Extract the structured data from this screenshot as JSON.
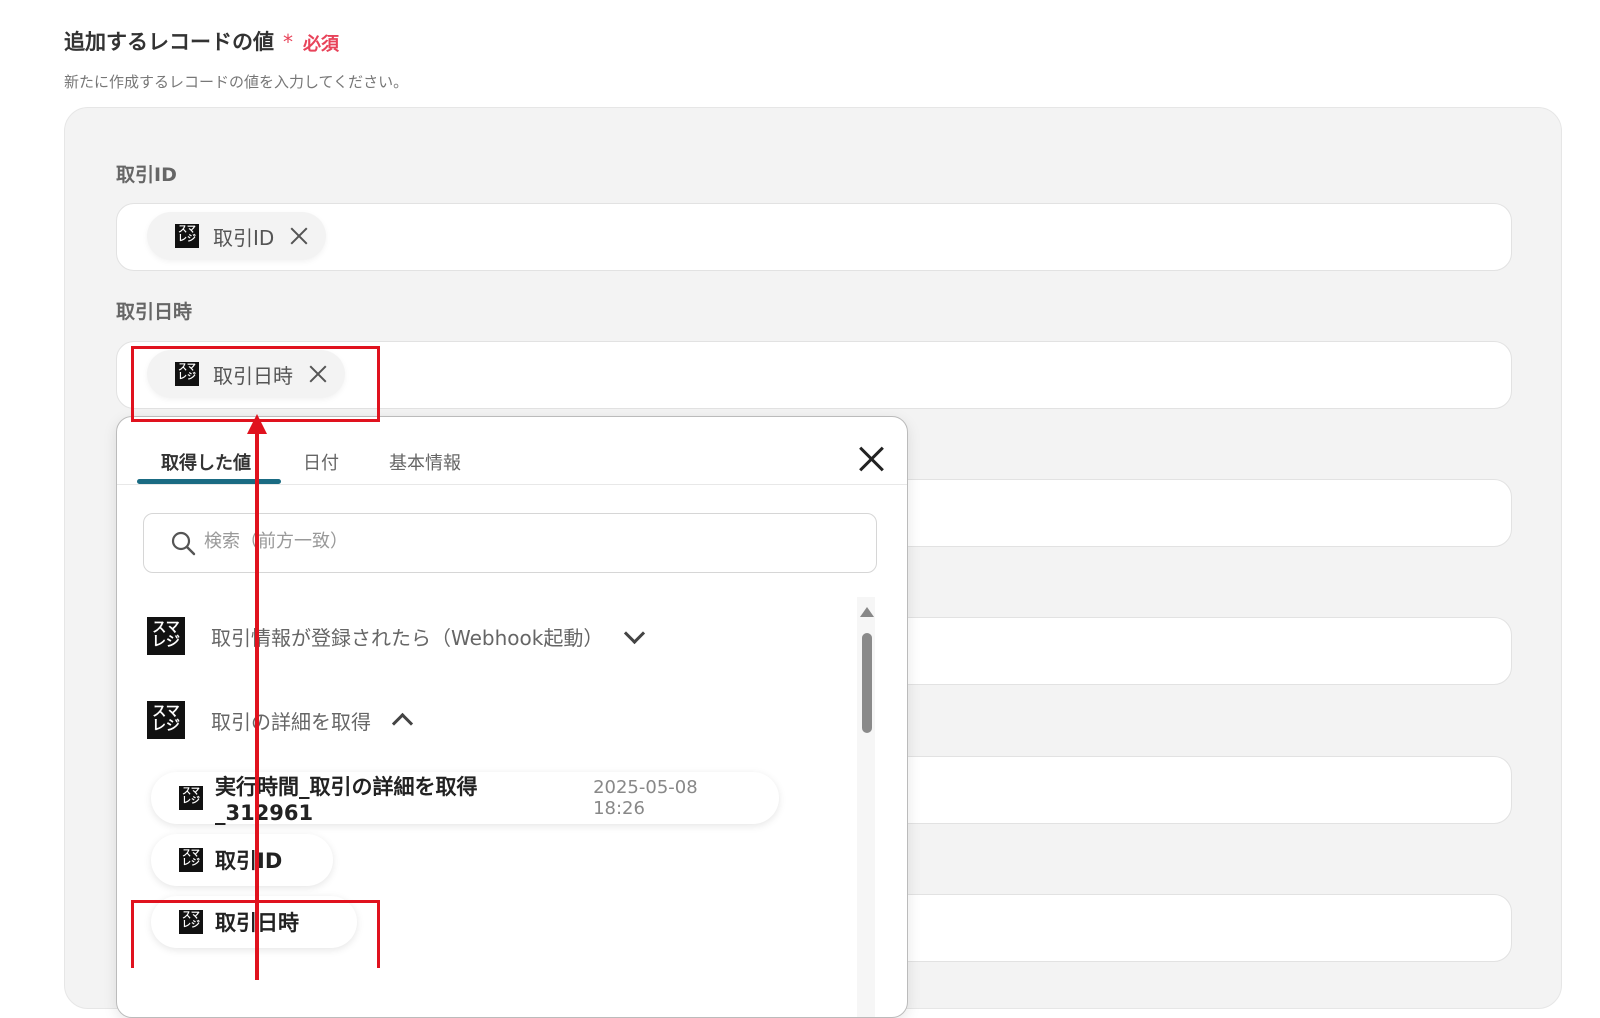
{
  "section": {
    "title": "追加するレコードの値",
    "required_mark": "*",
    "required_label": "必須",
    "description": "新たに作成するレコードの値を入力してください。"
  },
  "fields": [
    {
      "label": "取引ID",
      "chip": "取引ID"
    },
    {
      "label": "取引日時",
      "chip": "取引日時"
    }
  ],
  "logo_text": "スマレジ",
  "picker": {
    "tabs": [
      "取得した値",
      "日付",
      "基本情報"
    ],
    "active_tab": "取得した値",
    "search_placeholder": "検索（前方一致）",
    "groups": [
      {
        "label": "取引情報が登録されたら（Webhook起動）",
        "expanded": false
      },
      {
        "label": "取引の詳細を取得",
        "expanded": true
      }
    ],
    "items": [
      {
        "label": "実行時間_取引の詳細を取得_312961",
        "value": "2025-05-08 18:26"
      },
      {
        "label": "取引ID",
        "value": ""
      },
      {
        "label": "取引日時",
        "value": ""
      }
    ]
  },
  "colors": {
    "required": "#e8435a",
    "highlight": "#e0121e",
    "tab_underline": "#1a6b83"
  }
}
